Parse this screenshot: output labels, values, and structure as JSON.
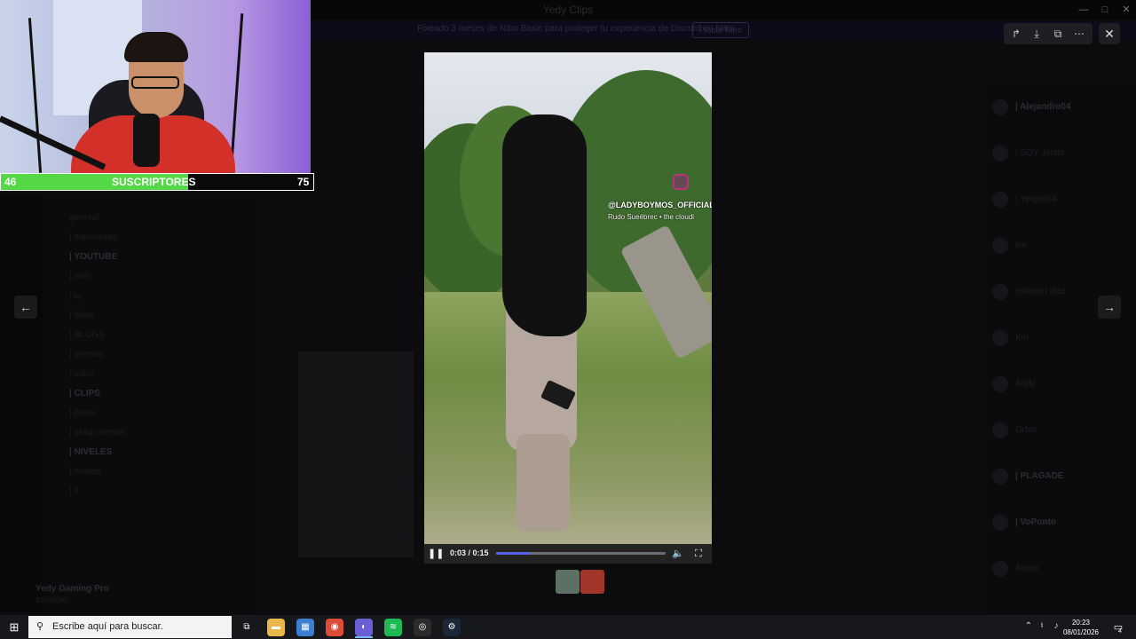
{
  "window": {
    "title": "Yedy Clips",
    "controls": [
      "—",
      "□",
      "✕"
    ]
  },
  "banner": {
    "text": "Fixeado 3 meses de Nitro Basic para proteger tu experiencia de Discord en Nitro",
    "button_label": "Probar Nitro"
  },
  "channels": [
    {
      "label": "general",
      "bright": false
    },
    {
      "label": "| entrevistas",
      "bright": false
    },
    {
      "label": "| YOUTUBE",
      "bright": true
    },
    {
      "label": "| web",
      "bright": false
    },
    {
      "label": "| ig",
      "bright": false
    },
    {
      "label": "| tiktok",
      "bright": false
    },
    {
      "label": "| BLOGS",
      "bright": false
    },
    {
      "label": "| memes",
      "bright": false
    },
    {
      "label": "| voice",
      "bright": false
    },
    {
      "label": "| CLIPS",
      "bright": true
    },
    {
      "label": "| posts",
      "bright": false
    },
    {
      "label": "| setup-stream",
      "bright": false
    },
    {
      "label": "| NIVELES",
      "bright": true
    },
    {
      "label": "| niveles",
      "bright": false
    },
    {
      "label": "| b",
      "bright": false
    }
  ],
  "user_panel": {
    "name": "Yedy Gaming Pro",
    "status": "Invisible"
  },
  "members": [
    {
      "label": "| Alejandro04",
      "bright": true
    },
    {
      "label": "| SOY Jimito",
      "bright": false
    },
    {
      "label": "| Yeigeno4",
      "bright": false
    },
    {
      "label": "jek",
      "bright": false
    },
    {
      "label": "esteban diaz",
      "bright": false
    },
    {
      "label": "Kiu",
      "bright": false
    },
    {
      "label": "Andy",
      "bright": false
    },
    {
      "label": "Grfax",
      "bright": false
    },
    {
      "label": "| PLAGADE",
      "bright": true
    },
    {
      "label": "| VoPonto",
      "bright": true
    },
    {
      "label": "Ateeo",
      "bright": false
    }
  ],
  "webcam": {
    "subs_label": "SUSCRIPTORES",
    "subs_current": "46",
    "subs_goal": "75",
    "subs_progress": 0.6
  },
  "viewer": {
    "overlay_handle": "@LADYBOYMOS_OFFICIAL",
    "overlay_sub": "Rudo Sueébrec • the cloudi",
    "time_current": "0:03",
    "time_total": "0:15",
    "time_display": "0:03 / 0:15",
    "progress": 0.2,
    "action_icons": [
      "share-icon",
      "download-icon",
      "open-external-icon",
      "more-icon"
    ],
    "thumbnails": [
      {
        "name": "thumbnail-1",
        "color": "#5d7064"
      },
      {
        "name": "thumbnail-2",
        "color": "#a3362a"
      }
    ]
  },
  "colors": {
    "accent": "#5865f2",
    "subs_bar": "#54d846"
  },
  "taskbar": {
    "search_placeholder": "Escribe aquí para buscar.",
    "apps": [
      {
        "name": "task-view-icon",
        "color": "#16181c",
        "glyph": "⧉",
        "active": false
      },
      {
        "name": "file-explorer-icon",
        "color": "#e8b94a",
        "glyph": "▬",
        "active": false
      },
      {
        "name": "store-icon",
        "color": "#3b7fd4",
        "glyph": "▦",
        "active": false
      },
      {
        "name": "chrome-icon",
        "color": "#dd4b39",
        "glyph": "◉",
        "active": false
      },
      {
        "name": "discord-icon",
        "color": "#6b5fd6",
        "glyph": "◐",
        "active": true
      },
      {
        "name": "spotify-icon",
        "color": "#1db954",
        "glyph": "≋",
        "active": false
      },
      {
        "name": "obs-icon",
        "color": "#2c2c2c",
        "glyph": "◎",
        "active": false
      },
      {
        "name": "steam-icon",
        "color": "#1b2838",
        "glyph": "⚙",
        "active": false
      }
    ],
    "time": "20:23",
    "date": "08/01/2026",
    "notifications": "4"
  }
}
